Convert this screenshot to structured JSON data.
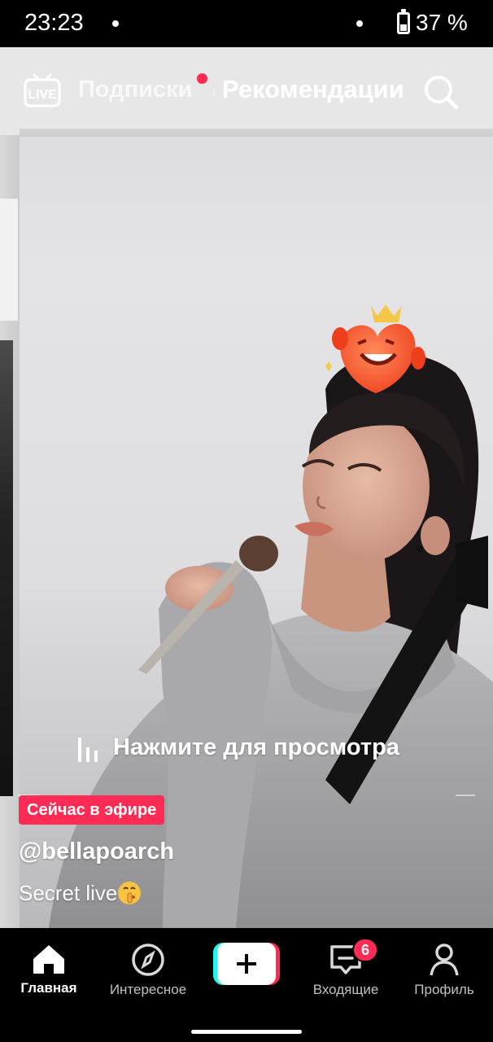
{
  "status_bar": {
    "time": "23:23",
    "battery": "37 %",
    "battery_level_percent": 37
  },
  "top_nav": {
    "live_icon": "live-tv-icon",
    "tabs": [
      {
        "label": "Подписки",
        "active": false,
        "has_notification_dot": true
      },
      {
        "label": "Рекомендации",
        "active": true
      }
    ],
    "search_icon": "search-icon"
  },
  "video": {
    "watch_prompt": "Нажмите для просмотра",
    "live_badge": "Сейчас в эфире",
    "username": "@bellapoarch",
    "caption": "Secret live",
    "caption_emoji": "shushing-face-emoji",
    "effect_icon": "heart-crown-sticker"
  },
  "bottom_nav": {
    "items": [
      {
        "label": "Главная",
        "icon": "home-icon",
        "active": true
      },
      {
        "label": "Интересное",
        "icon": "compass-icon",
        "active": false
      },
      {
        "label": "",
        "icon": "plus-create-icon",
        "active": false
      },
      {
        "label": "Входящие",
        "icon": "inbox-icon",
        "active": false,
        "badge": "6"
      },
      {
        "label": "Профиль",
        "icon": "profile-icon",
        "active": false
      }
    ]
  },
  "colors": {
    "accent": "#fe2c55",
    "cyan": "#25f4ee",
    "background": "#000000"
  }
}
